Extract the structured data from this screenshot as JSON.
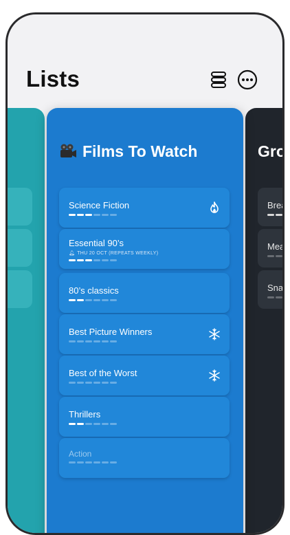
{
  "header": {
    "title": "Lists",
    "stack_icon": "stack-icon",
    "more_icon": "ellipsis-circle-icon"
  },
  "main_list": {
    "title": "Films To Watch",
    "title_icon": "film-camera-icon",
    "color": "#1c7bcf",
    "items": [
      {
        "name": "Science Fiction",
        "icon": "flame-icon",
        "progress": 0.5
      },
      {
        "name": "Essential 90’s",
        "subtitle": "THU 20 OCT (REPEATS WEEKLY)",
        "subtitle_icon": "bell-icon",
        "progress": 0.5
      },
      {
        "name": "80’s classics",
        "progress": 0.33
      },
      {
        "name": "Best Picture Winners",
        "icon": "snowflake-icon",
        "progress": 0.0
      },
      {
        "name": "Best of the Worst",
        "icon": "snowflake-icon",
        "progress": 0.0
      },
      {
        "name": "Thrillers",
        "progress": 0.33
      },
      {
        "name": "Action",
        "progress": 0.0
      }
    ]
  },
  "right_list": {
    "title": "Gro",
    "color": "#20252c",
    "items": [
      {
        "name": "Brea"
      },
      {
        "name": "Mea"
      },
      {
        "name": "Sna"
      }
    ]
  },
  "left_list": {
    "color": "#23a3ad"
  }
}
